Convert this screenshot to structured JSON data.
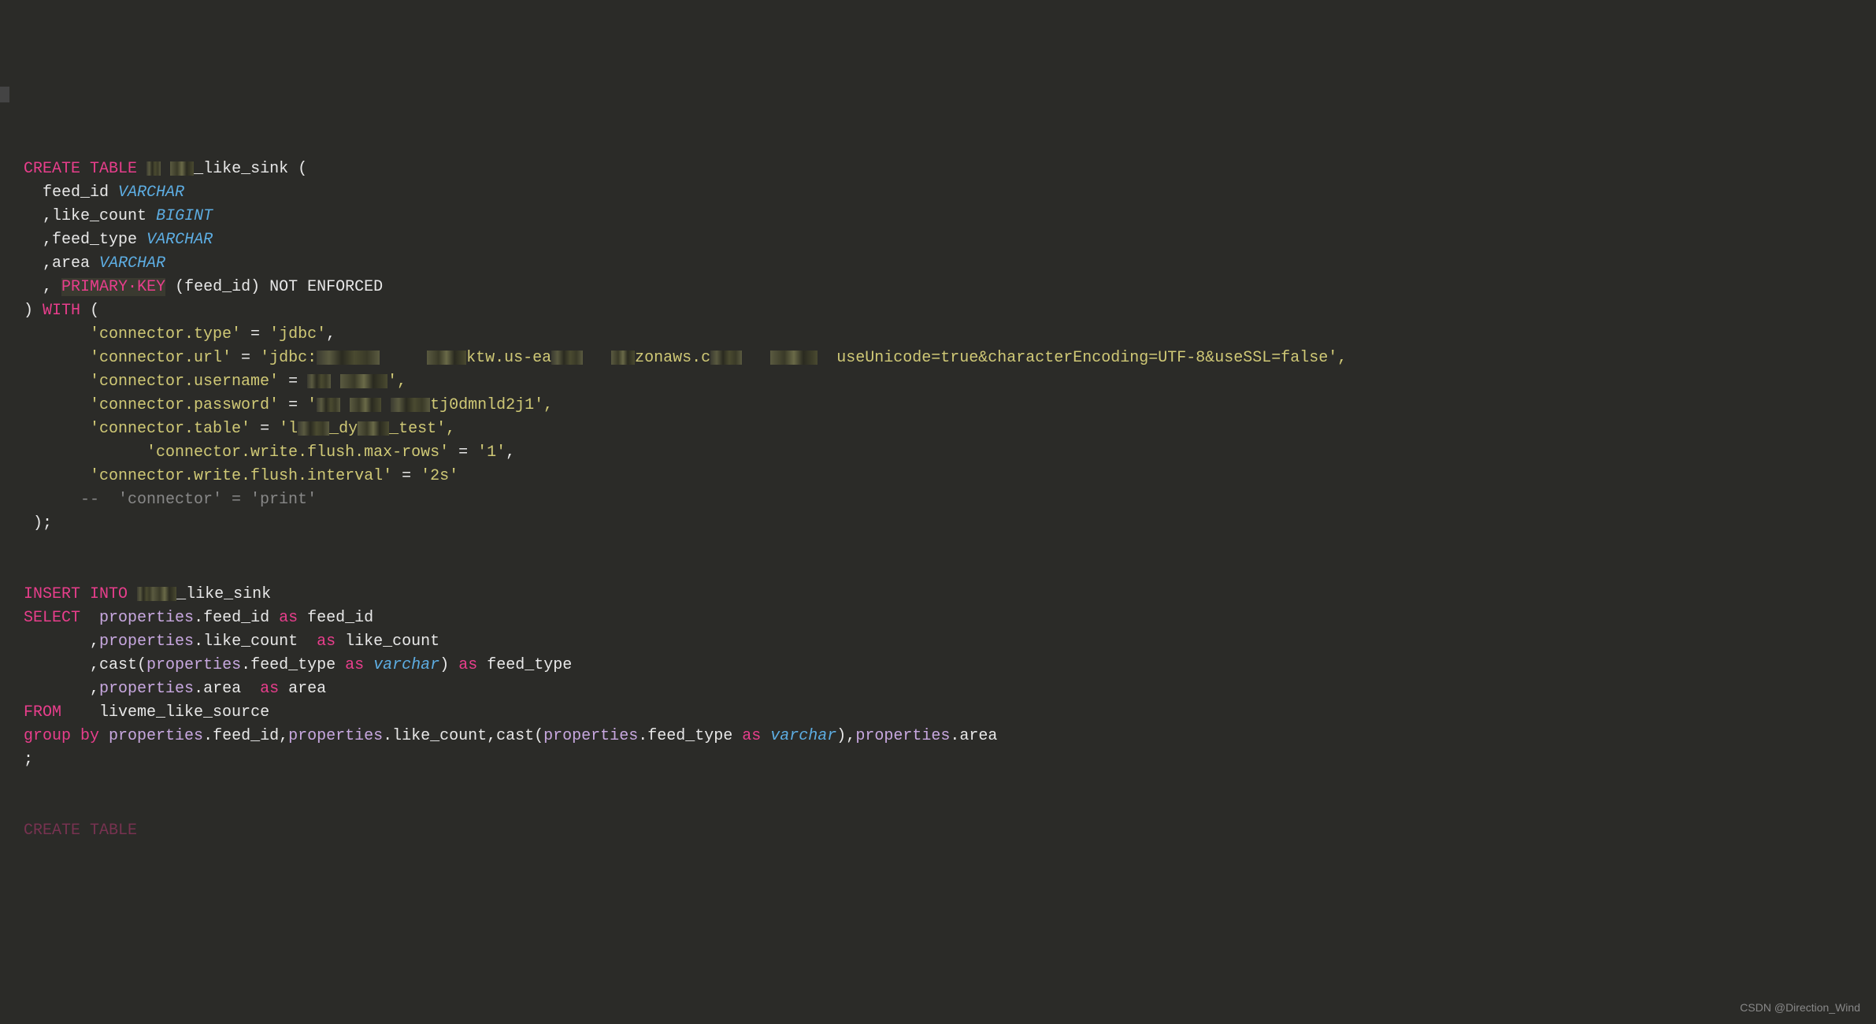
{
  "code": {
    "line1": {
      "kw1": "CREATE",
      "kw2": "TABLE",
      "name_suffix": "_like_sink ("
    },
    "line2": {
      "col": "feed_id",
      "type": "VARCHAR"
    },
    "line3": {
      "col": ",like_count",
      "type": "BIGINT"
    },
    "line4": {
      "col": ",feed_type",
      "type": "VARCHAR"
    },
    "line5": {
      "col": ",area",
      "type": "VARCHAR"
    },
    "line6": {
      "punct1": ",",
      "kw": "PRIMARY·KEY",
      "rest": "(feed_id) NOT ENFORCED"
    },
    "line7": {
      "punct": ")",
      "kw": "WITH",
      "paren": "("
    },
    "line8": {
      "key": "'connector.type'",
      "eq": " = ",
      "val": "'jdbc'",
      "comma": ","
    },
    "line9": {
      "key": "'connector.url'",
      "eq": " = ",
      "val_start": "'jdbc:",
      "val_mid": "ktw.us-ea",
      "val_mid2": "zonaws.c",
      "val_end": "useUnicode=true&characterEncoding=UTF-8&useSSL=false',"
    },
    "line10": {
      "key": "'connector.username'",
      "eq": " = ",
      "val_end": "',"
    },
    "line11": {
      "key": "'connector.password'",
      "eq": " = ",
      "val_start": "'",
      "val_end": "tj0dmnld2j1',"
    },
    "line12": {
      "key": "'connector.table'",
      "eq": " = ",
      "val_start": "'l",
      "val_mid": "_dy",
      "val_end": "_test',"
    },
    "line13": {
      "key": "'connector.write.flush.max-rows'",
      "eq": " = ",
      "val": "'1'",
      "comma": ","
    },
    "line14": {
      "key": "'connector.write.flush.interval'",
      "eq": " = ",
      "val": "'2s'"
    },
    "line15": {
      "comment": "--  'connector' = 'print'"
    },
    "line16": {
      "close": ");"
    },
    "line18": {
      "kw1": "INSERT",
      "kw2": "INTO",
      "name_suffix": "_like_sink"
    },
    "line19": {
      "kw": "SELECT",
      "prop": "properties",
      "dot": ".",
      "field": "feed_id",
      "as": "as",
      "alias": "feed_id"
    },
    "line20": {
      "comma": ",",
      "prop": "properties",
      "dot": ".",
      "field": "like_count",
      "as": "as",
      "alias": "like_count"
    },
    "line21": {
      "comma": ",",
      "cast": "cast(",
      "prop": "properties",
      "dot": ".",
      "field": "feed_type",
      "as1": "as",
      "type": "varchar",
      "close": ")",
      "as2": "as",
      "alias": "feed_type"
    },
    "line22": {
      "comma": ",",
      "prop": "properties",
      "dot": ".",
      "field": "area",
      "as": "as",
      "alias": "area"
    },
    "line23": {
      "kw": "FROM",
      "table": "liveme_like_source"
    },
    "line24": {
      "kw": "group by",
      "p1": "properties",
      "f1": ".feed_id,",
      "p2": "properties",
      "f2": ".like_count,",
      "cast": "cast(",
      "p3": "properties",
      "f3": ".feed_type",
      "as": "as",
      "type": "varchar",
      "close": "),",
      "p4": "properties",
      "f4": ".area"
    },
    "line25": {
      "semi": ";"
    },
    "line27": {
      "kw1": "CREATE",
      "kw2": "TABLE"
    }
  },
  "watermark": "CSDN @Direction_Wind"
}
